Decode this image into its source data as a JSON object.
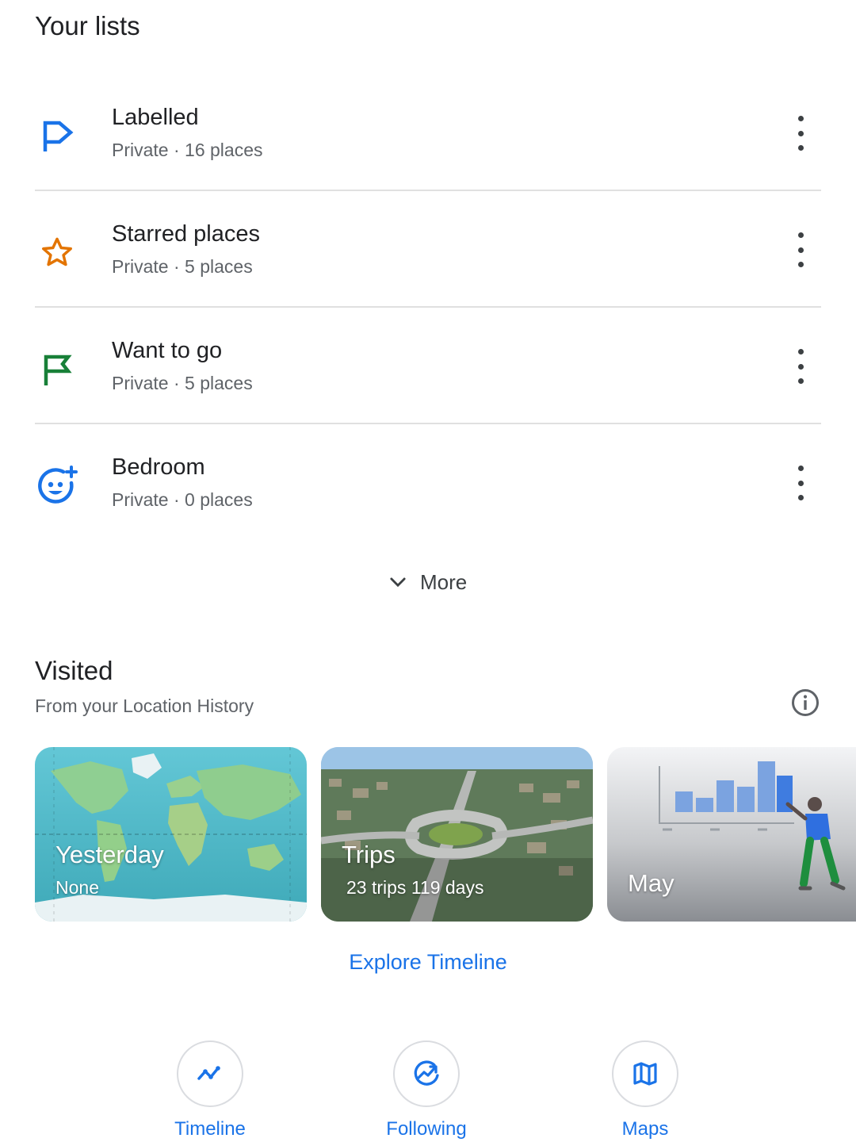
{
  "lists_section": {
    "title": "Your lists"
  },
  "lists": [
    {
      "name": "Labelled",
      "privacy": "Private",
      "count": "16 places",
      "icon": "label-flag-icon",
      "color": "#1a73e8"
    },
    {
      "name": "Starred places",
      "privacy": "Private",
      "count": "5 places",
      "icon": "star-icon",
      "color": "#e37400"
    },
    {
      "name": "Want to go",
      "privacy": "Private",
      "count": "5 places",
      "icon": "flag-icon",
      "color": "#188038"
    },
    {
      "name": "Bedroom",
      "privacy": "Private",
      "count": "0 places",
      "icon": "emoji-add-icon",
      "color": "#1a73e8"
    }
  ],
  "more": {
    "label": "More"
  },
  "visited": {
    "title": "Visited",
    "subtitle": "From your Location History"
  },
  "cards": [
    {
      "title": "Yesterday",
      "subtitle": "None"
    },
    {
      "title": "Trips",
      "subtitle": "23 trips  119 days"
    },
    {
      "title": "May"
    }
  ],
  "explore_link": "Explore Timeline",
  "bottom_nav": [
    {
      "label": "Timeline",
      "icon": "timeline-icon"
    },
    {
      "label": "Following",
      "icon": "following-icon"
    },
    {
      "label": "Maps",
      "icon": "map-icon"
    }
  ],
  "colors": {
    "accent": "#1a73e8",
    "text": "#202124",
    "secondary": "#5f6368"
  }
}
